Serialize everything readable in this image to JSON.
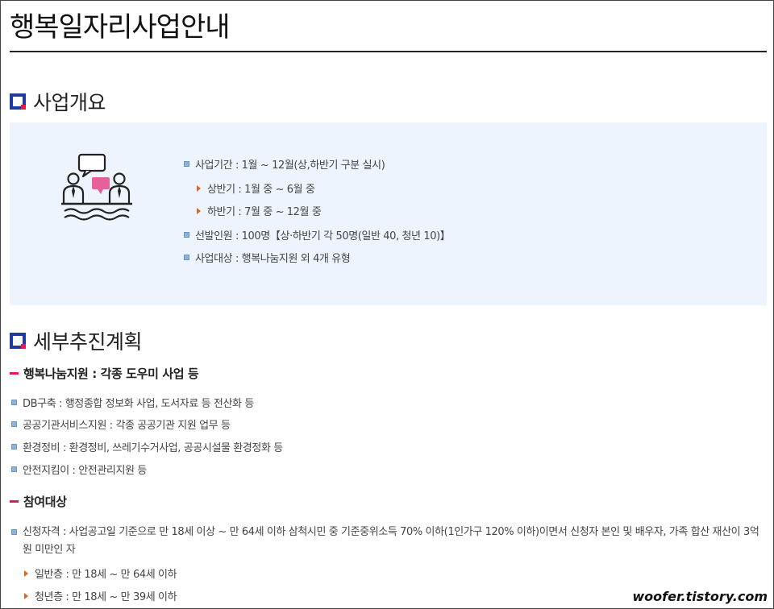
{
  "page": {
    "title": "행복일자리사업안내"
  },
  "overview": {
    "heading": "사업개요",
    "icon": "meeting-conversation-icon",
    "items": [
      {
        "label": "사업기간 : 1월 ~ 12월(상,하반기 구분 실시)"
      },
      {
        "label": "상반기 : 1월 중 ~ 6월 중"
      },
      {
        "label": "하반기 : 7월 중 ~ 12월 중"
      },
      {
        "label": "선발인원 : 100명【상·하반기 각 50명(일반 40, 청년 10)】"
      },
      {
        "label": "사업대상 : 행복나눔지원 외 4개 유형"
      }
    ]
  },
  "plan": {
    "heading": "세부추진계획",
    "sub1": {
      "title": "행복나눔지원 : 각종 도우미 사업 등",
      "items": [
        "DB구축 : 행정종합 정보화 사업, 도서자료 등 전산화 등",
        "공공기관서비스지원 : 각종 공공기관 지원 업무 등",
        "환경정비 : 환경정비, 쓰레기수거사업, 공공시설물 환경정화 등",
        "안전지킴이 : 안전관리지원 등"
      ]
    },
    "sub2": {
      "title": "참여대상",
      "qualification": "신청자격 : 사업공고일 기준으로 만 18세 이상 ~ 만 64세 이하 삼척시민 중 기준중위소득 70% 이하(1인가구 120% 이하)이면서 신청자 본인 및 배우자, 가족 합산 재산이 3억원 미만인 자",
      "items": [
        "일반층 : 만 18세 ~ 만 64세 이하",
        "청년층 : 만 18세 ~ 만 39세 이하"
      ]
    }
  },
  "watermark": "woofer.tistory.com",
  "colors": {
    "accent_blue": "#1f3c9c",
    "accent_red": "#e21b4f",
    "box_bg": "#edf4fd",
    "bullet_orange": "#d46a28"
  }
}
